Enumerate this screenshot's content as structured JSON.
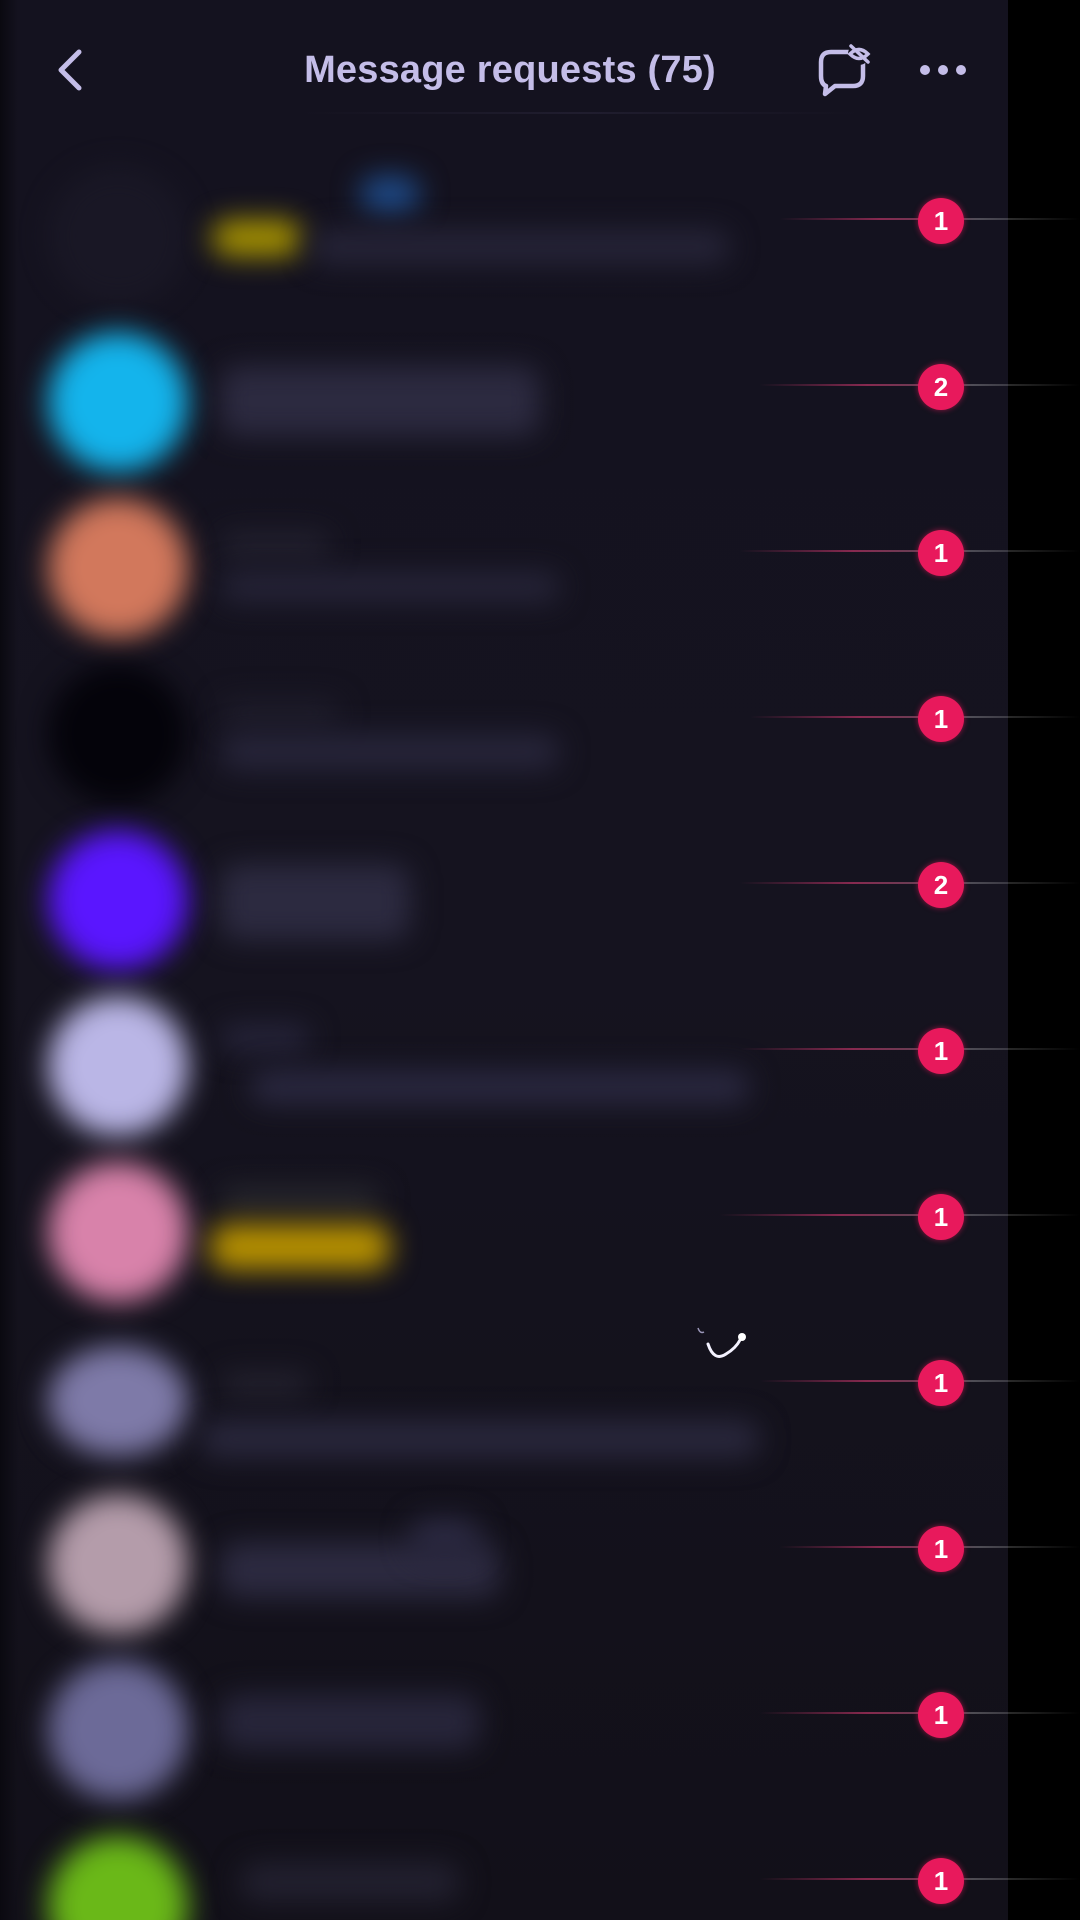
{
  "header": {
    "back_icon": "chevron-left-icon",
    "title": "Message requests (75)",
    "chat_off_icon": "chat-bubble-off-icon",
    "more_icon": "ellipsis-horizontal-icon"
  },
  "requests": [
    {
      "unread": "1",
      "avatar_color": "#1a1826",
      "accent_color": "#b8a800"
    },
    {
      "unread": "2",
      "avatar_color": "#14b4ec",
      "accent_color": ""
    },
    {
      "unread": "1",
      "avatar_color": "#d2785c",
      "accent_color": ""
    },
    {
      "unread": "1",
      "avatar_color": "#04030a",
      "accent_color": ""
    },
    {
      "unread": "2",
      "avatar_color": "#5a16ff",
      "accent_color": ""
    },
    {
      "unread": "1",
      "avatar_color": "#bab6e6",
      "accent_color": ""
    },
    {
      "unread": "1",
      "avatar_color": "#d882aa",
      "accent_color": "#c8a000"
    },
    {
      "unread": "1",
      "avatar_color": "#7e7aa8",
      "accent_color": ""
    },
    {
      "unread": "1",
      "avatar_color": "#b49caa",
      "accent_color": ""
    },
    {
      "unread": "1",
      "avatar_color": "#6c6a98",
      "accent_color": ""
    },
    {
      "unread": "1",
      "avatar_color": "#6ab818",
      "accent_color": ""
    }
  ],
  "colors": {
    "background": "#14121f",
    "title_text": "#c4bde8",
    "badge": "#e8195c",
    "icon": "#c4bde8"
  }
}
